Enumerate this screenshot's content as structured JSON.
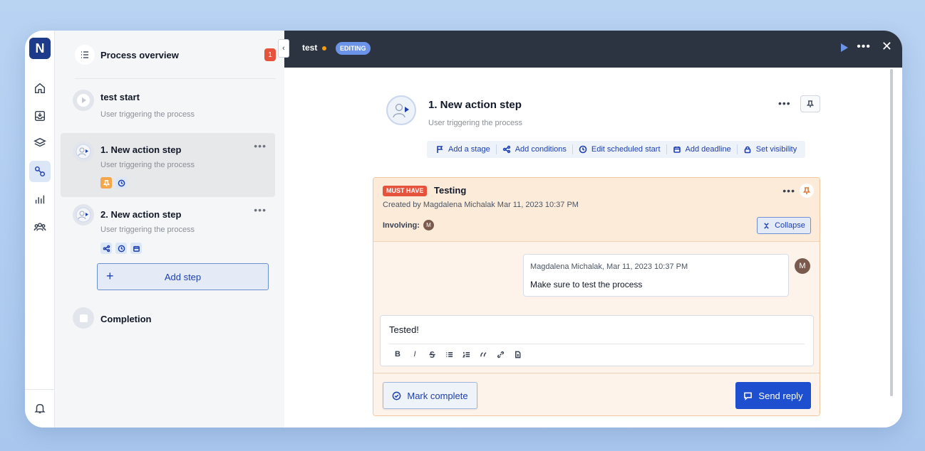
{
  "app": {
    "logo_letter": "N"
  },
  "overview": {
    "title": "Process overview",
    "badge": "1"
  },
  "steps": [
    {
      "name": "test start",
      "sub": "User triggering the process"
    },
    {
      "name": "1. New action step",
      "sub": "User triggering the process",
      "more": "•••"
    },
    {
      "name": "2. New action step",
      "sub": "User triggering the process",
      "more": "•••"
    }
  ],
  "add_step": {
    "plus": "+",
    "label": "Add step"
  },
  "completion": {
    "name": "Completion"
  },
  "topbar": {
    "title": "test",
    "status": "EDITING",
    "more": "•••",
    "close": "✕",
    "collapse": "‹"
  },
  "header": {
    "title": "1. New action step",
    "sub": "User triggering the process",
    "more": "•••"
  },
  "actions": [
    {
      "label": "Add a stage",
      "icon": "flag-icon"
    },
    {
      "label": "Add conditions",
      "icon": "branch-icon"
    },
    {
      "label": "Edit scheduled start",
      "icon": "clock-icon"
    },
    {
      "label": "Add deadline",
      "icon": "calendar-icon"
    },
    {
      "label": "Set visibility",
      "icon": "lock-icon"
    }
  ],
  "card": {
    "badge": "MUST HAVE",
    "title": "Testing",
    "created": "Created by Magdalena Michalak Mar 11, 2023 10:37 PM",
    "involving": "Involving:",
    "involving_avatar": "M",
    "more": "•••",
    "collapse": "Collapse"
  },
  "comment": {
    "meta": "Magdalena Michalak, Mar 11, 2023 10:37 PM",
    "text": "Make sure to test the process",
    "avatar": "M"
  },
  "reply": {
    "text": "Tested!",
    "tools": [
      "B",
      "I"
    ]
  },
  "footer": {
    "mark_complete": "Mark complete",
    "send_reply": "Send reply"
  },
  "colors": {
    "accent": "#1e4fcf",
    "danger": "#e5533d",
    "topbar": "#2b3440",
    "card_bg": "#fdebd9"
  }
}
